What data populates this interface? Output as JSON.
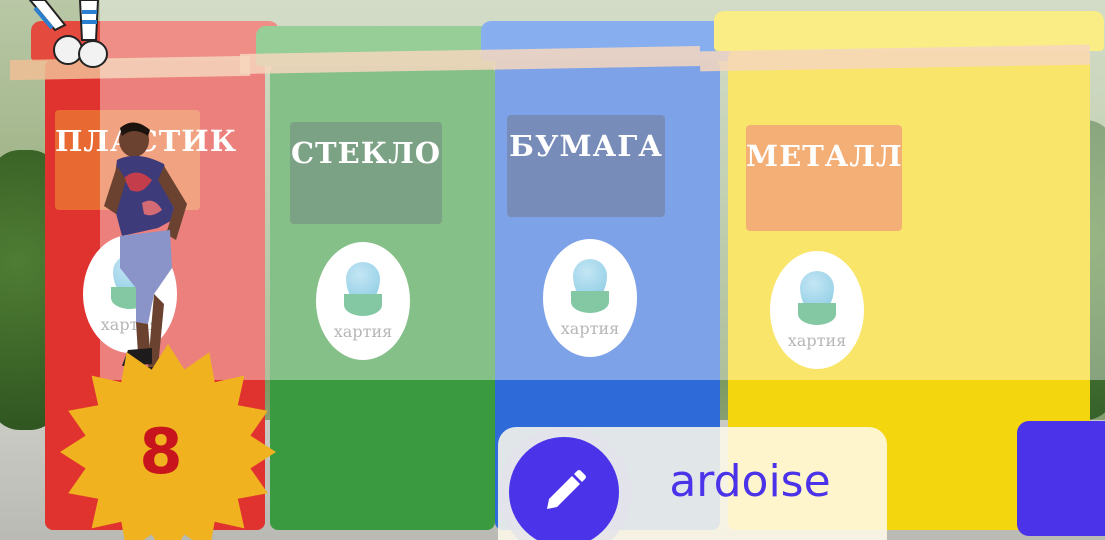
{
  "scene": {
    "bins": [
      {
        "label": "ПЛАСТИК",
        "color": "#e0322e",
        "brand": "хартия"
      },
      {
        "label": "СТЕКЛО",
        "color": "#3a9a3f",
        "brand": "хартия"
      },
      {
        "label": "БУМАГА",
        "color": "#2e6ad8",
        "brand": "хартия"
      },
      {
        "label": "МЕТАЛЛ",
        "color": "#f4d60f",
        "brand": "хартия"
      }
    ]
  },
  "game": {
    "level": "8",
    "word": "ardoise",
    "accent_color": "#4a33e8",
    "badge_color": "#f0b21f",
    "level_color": "#c8141c"
  },
  "icons": {
    "edit": "pencil-icon",
    "badge": "star-burst-icon"
  }
}
